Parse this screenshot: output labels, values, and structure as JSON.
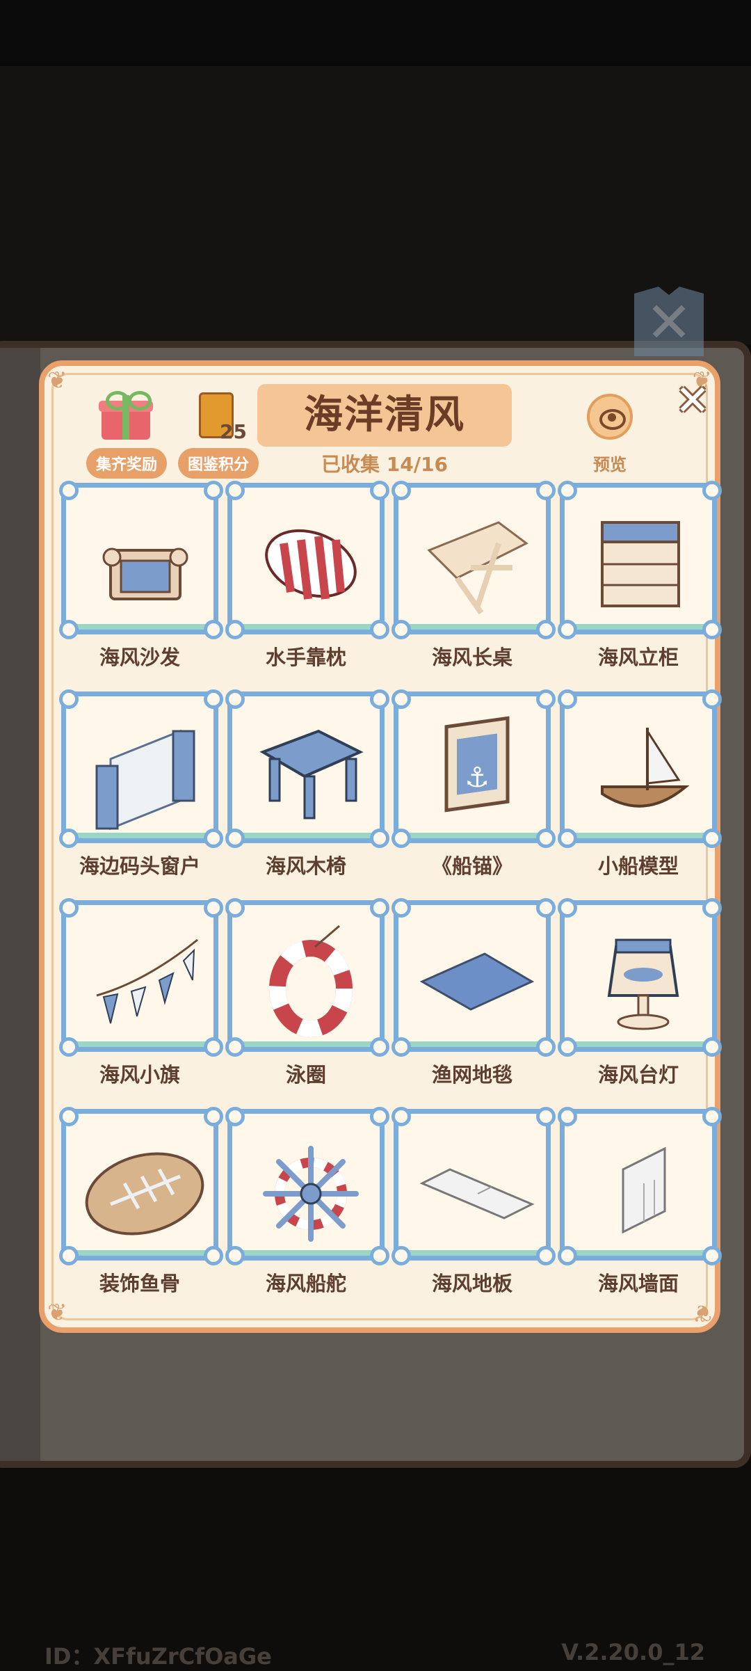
{
  "header": {
    "rewards_label": "集齐奖励",
    "points_label": "图鉴积分",
    "points_count": "25",
    "title": "海洋清风",
    "collected": "已收集 14/16",
    "preview_label": "预览",
    "close_icon": "close-icon"
  },
  "items": [
    {
      "name": "海风沙发",
      "icon": "sofa-icon"
    },
    {
      "name": "水手靠枕",
      "icon": "pillow-icon"
    },
    {
      "name": "海风长桌",
      "icon": "table-icon"
    },
    {
      "name": "海风立柜",
      "icon": "cabinet-icon"
    },
    {
      "name": "海边码头窗户",
      "icon": "window-icon"
    },
    {
      "name": "海风木椅",
      "icon": "stool-icon"
    },
    {
      "name": "《船锚》",
      "icon": "anchor-painting-icon"
    },
    {
      "name": "小船模型",
      "icon": "boat-icon"
    },
    {
      "name": "海风小旗",
      "icon": "bunting-icon"
    },
    {
      "name": "泳圈",
      "icon": "lifebuoy-icon"
    },
    {
      "name": "渔网地毯",
      "icon": "rug-icon"
    },
    {
      "name": "海风台灯",
      "icon": "lamp-icon"
    },
    {
      "name": "装饰鱼骨",
      "icon": "fishbone-plaque-icon"
    },
    {
      "name": "海风船舵",
      "icon": "ship-wheel-icon"
    },
    {
      "name": "海风地板",
      "icon": "floor-icon"
    },
    {
      "name": "海风墙面",
      "icon": "wall-icon"
    }
  ],
  "footer": {
    "id": "ID：XFfuZrCfOaGe",
    "version": "V.2.20.0_12"
  }
}
